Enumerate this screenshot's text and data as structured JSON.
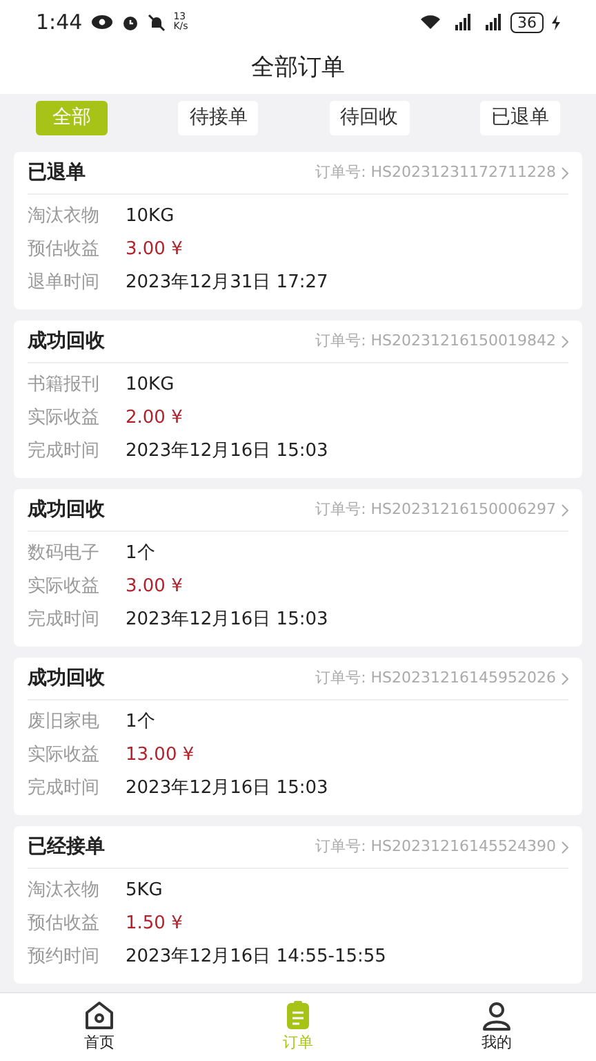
{
  "status_bar": {
    "time": "1:44",
    "speed_value": "13",
    "speed_unit": "K/s",
    "battery": "36"
  },
  "title": "全部订单",
  "tabs": [
    {
      "label": "全部",
      "selected": true
    },
    {
      "label": "待接单",
      "selected": false
    },
    {
      "label": "待回收",
      "selected": false
    },
    {
      "label": "已退单",
      "selected": false
    }
  ],
  "orders": [
    {
      "status": "已退单",
      "order_no": "订单号: HS20231231172711228",
      "rows": [
        {
          "label": "淘汰衣物",
          "value": "10KG",
          "kind": "text"
        },
        {
          "label": "预估收益",
          "value": "3.00 ¥",
          "kind": "amount"
        },
        {
          "label": "退单时间",
          "value": "2023年12月31日 17:27",
          "kind": "text"
        }
      ]
    },
    {
      "status": "成功回收",
      "order_no": "订单号: HS20231216150019842",
      "rows": [
        {
          "label": "书籍报刊",
          "value": "10KG",
          "kind": "text"
        },
        {
          "label": "实际收益",
          "value": "2.00 ¥",
          "kind": "amount"
        },
        {
          "label": "完成时间",
          "value": "2023年12月16日 15:03",
          "kind": "text"
        }
      ]
    },
    {
      "status": "成功回收",
      "order_no": "订单号: HS20231216150006297",
      "rows": [
        {
          "label": "数码电子",
          "value": "1个",
          "kind": "text"
        },
        {
          "label": "实际收益",
          "value": "3.00 ¥",
          "kind": "amount"
        },
        {
          "label": "完成时间",
          "value": "2023年12月16日 15:03",
          "kind": "text"
        }
      ]
    },
    {
      "status": "成功回收",
      "order_no": "订单号: HS20231216145952026",
      "rows": [
        {
          "label": "废旧家电",
          "value": "1个",
          "kind": "text"
        },
        {
          "label": "实际收益",
          "value": "13.00 ¥",
          "kind": "amount"
        },
        {
          "label": "完成时间",
          "value": "2023年12月16日 15:03",
          "kind": "text"
        }
      ]
    },
    {
      "status": "已经接单",
      "order_no": "订单号: HS20231216145524390",
      "rows": [
        {
          "label": "淘汰衣物",
          "value": "5KG",
          "kind": "text"
        },
        {
          "label": "预估收益",
          "value": "1.50 ¥",
          "kind": "amount"
        },
        {
          "label": "预约时间",
          "value": "2023年12月16日 14:55-15:55",
          "kind": "text"
        }
      ]
    }
  ],
  "nav": [
    {
      "label": "首页",
      "kind": "home",
      "selected": false
    },
    {
      "label": "订单",
      "kind": "orders",
      "selected": true
    },
    {
      "label": "我的",
      "kind": "user",
      "selected": false
    }
  ]
}
